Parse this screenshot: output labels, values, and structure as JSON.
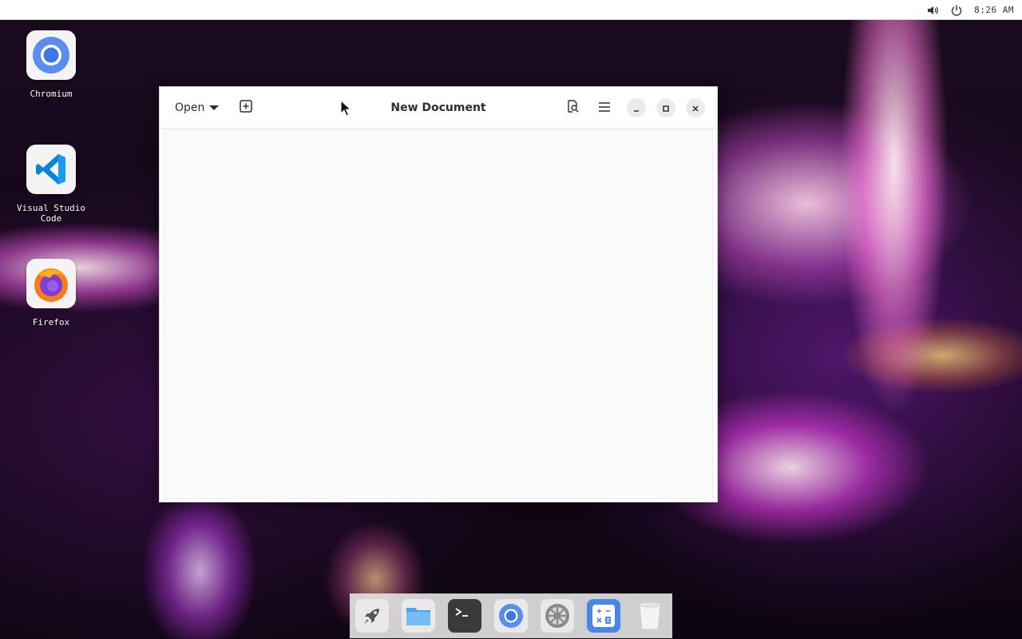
{
  "topbar": {
    "clock": "8:26 AM",
    "icons": [
      "volume-icon",
      "power-icon"
    ]
  },
  "desktop": {
    "icons": [
      {
        "label": "Chromium",
        "icon": "chromium-icon"
      },
      {
        "label": "Visual Studio Code",
        "icon": "vscode-icon"
      },
      {
        "label": "Firefox",
        "icon": "firefox-icon"
      }
    ]
  },
  "window": {
    "title": "New Document",
    "open_label": "Open",
    "editor_text": "",
    "buttons": [
      "new-tab-icon",
      "search-document-icon",
      "hamburger-menu-icon",
      "minimize-icon",
      "maximize-icon",
      "close-icon"
    ]
  },
  "dock": {
    "items": [
      "launcher-rocket-icon",
      "files-folder-icon",
      "terminal-icon",
      "chromium-icon",
      "settings-gear-icon",
      "calculator-icon",
      "trash-icon"
    ]
  },
  "colors": {
    "accent_blue": "#4a86e8",
    "vscode_blue": "#0a84d8",
    "firefox_orange": "#ff7a1a",
    "terminal_dark": "#3a3a3a"
  }
}
